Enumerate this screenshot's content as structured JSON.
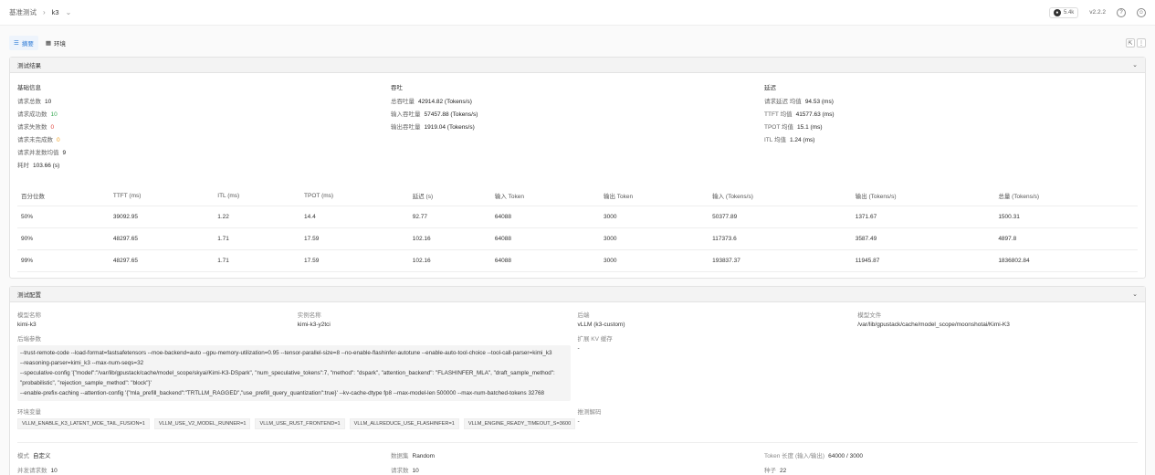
{
  "breadcrumb": {
    "parent": "基准测试",
    "current": "k3"
  },
  "header": {
    "github_count": "5.4k",
    "version": "v2.2.2"
  },
  "tabs": [
    {
      "label": "摘要"
    },
    {
      "label": "环境"
    }
  ],
  "results": {
    "title": "测试结果",
    "basic": {
      "title": "基础信息",
      "rows": [
        {
          "label": "请求总数",
          "value": "10"
        },
        {
          "label": "请求成功数",
          "value": "10"
        },
        {
          "label": "请求失败数",
          "value": "0"
        },
        {
          "label": "请求未完成数",
          "value": "0"
        },
        {
          "label": "请求并发数均值",
          "value": "9"
        },
        {
          "label": "耗时",
          "value": "103.66 (s)"
        }
      ]
    },
    "throughput": {
      "title": "吞吐",
      "rows": [
        {
          "label": "总吞吐量",
          "value": "42914.82 (Tokens/s)"
        },
        {
          "label": "输入吞吐量",
          "value": "57457.88 (Tokens/s)"
        },
        {
          "label": "输出吞吐量",
          "value": "1919.04 (Tokens/s)"
        }
      ]
    },
    "latency": {
      "title": "延迟",
      "rows": [
        {
          "label": "请求延迟 均值",
          "value": "94.53 (ms)"
        },
        {
          "label": "TTFT 均值",
          "value": "41577.63 (ms)"
        },
        {
          "label": "TPOT 均值",
          "value": "15.1 (ms)"
        },
        {
          "label": "ITL 均值",
          "value": "1.24 (ms)"
        }
      ]
    },
    "table": {
      "headers": [
        "百分位数",
        "TTFT (ms)",
        "ITL (ms)",
        "TPOT (ms)",
        "延迟 (s)",
        "输入 Token",
        "输出 Token",
        "输入 (Tokens/s)",
        "输出 (Tokens/s)",
        "总量 (Tokens/s)"
      ],
      "rows": [
        [
          "50%",
          "39092.95",
          "1.22",
          "14.4",
          "92.77",
          "64088",
          "3000",
          "50377.89",
          "1371.67",
          "1500.31"
        ],
        [
          "90%",
          "48297.65",
          "1.71",
          "17.59",
          "102.16",
          "64088",
          "3000",
          "117373.6",
          "3587.49",
          "4897.8"
        ],
        [
          "99%",
          "48297.65",
          "1.71",
          "17.59",
          "102.16",
          "64088",
          "3000",
          "193837.37",
          "11945.87",
          "1836802.84"
        ]
      ]
    }
  },
  "config": {
    "title": "测试配置",
    "model_name": {
      "label": "模型名称",
      "value": "kimi-k3"
    },
    "instance_name": {
      "label": "实例名称",
      "value": "kimi-k3-y2tci"
    },
    "backend": {
      "label": "后端",
      "value": "vLLM (k3-custom)"
    },
    "model_file": {
      "label": "模型文件",
      "value": "/var/lib/gpustack/cache/model_scope/moonshotai/Kimi-K3"
    },
    "args_label": "后端参数",
    "args_lines": [
      "--trust-remote-code  --load-format=fastsafetensors  --moe-backend=auto  --gpu-memory-utilization=0.95  --tensor-parallel-size=8  --no-enable-flashinfer-autotune  --enable-auto-tool-choice  --tool-call-parser=kimi_k3",
      "--reasoning-parser=kimi_k3  --max-num-seqs=32",
      "--speculative-config '{\"model\":\"/var/lib/gpustack/cache/model_scope/skyai/Kimi-K3-DSpark\", \"num_speculative_tokens\":7, \"method\": \"dspark\", \"attention_backend\": \"FLASHINFER_MLA\", \"draft_sample_method\":",
      "\"probabilistic\", \"rejection_sample_method\": \"block\"}'",
      "--enable-prefix-caching  --attention-config '{\"mla_prefill_backend\":\"TRTLLM_RAGGED\",\"use_prefill_query_quantization\":true}'  --kv-cache-dtype fp8  --max-model-len 500000  --max-num-batched-tokens 32768"
    ],
    "kv_cache": {
      "label": "扩展 KV 缓存",
      "value": "-"
    },
    "env_label": "环境变量",
    "env_tags": [
      "VLLM_ENABLE_K3_LATENT_MOE_TAIL_FUSION=1",
      "VLLM_USE_V2_MODEL_RUNNER=1",
      "VLLM_USE_RUST_FRONTEND=1",
      "VLLM_ALLREDUCE_USE_FLASHINFER=1",
      "VLLM_ENGINE_READY_TIMEOUT_S=3600"
    ],
    "spec_decode": {
      "label": "推测解码",
      "value": "-"
    },
    "mode": {
      "label": "模式",
      "value": "自定义"
    },
    "concurrency": {
      "label": "并发请求数",
      "value": "10"
    },
    "dataset": {
      "label": "数据集",
      "value": "Random"
    },
    "request_count": {
      "label": "请求数",
      "value": "10"
    },
    "token_length": {
      "label": "Token 长度 (输入/输出)",
      "value": "64000 / 3000"
    },
    "seed": {
      "label": "种子",
      "value": "22"
    }
  }
}
